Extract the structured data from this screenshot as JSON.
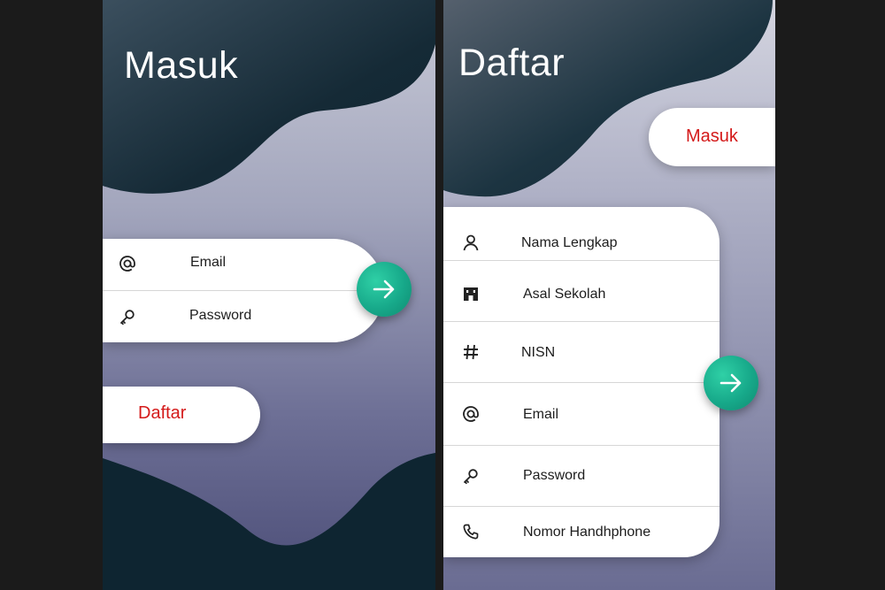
{
  "login": {
    "title": "Masuk",
    "fields": [
      {
        "icon": "at-icon",
        "label": "Email"
      },
      {
        "icon": "key-icon",
        "label": "Password"
      }
    ],
    "submit_icon": "arrow-right-icon",
    "switch_button": "Daftar"
  },
  "register": {
    "title": "Daftar",
    "switch_button": "Masuk",
    "fields": [
      {
        "icon": "person-icon",
        "label": "Nama Lengkap"
      },
      {
        "icon": "school-icon",
        "label": "Asal Sekolah"
      },
      {
        "icon": "hash-icon",
        "label": "NISN"
      },
      {
        "icon": "at-icon",
        "label": "Email"
      },
      {
        "icon": "key-icon",
        "label": "Password"
      },
      {
        "icon": "phone-icon",
        "label": "Nomor Handhphone"
      }
    ],
    "submit_icon": "arrow-right-icon"
  },
  "colors": {
    "dark_blob": "#102733",
    "accent_green": "#17a98a",
    "link_red": "#d41a1a"
  }
}
